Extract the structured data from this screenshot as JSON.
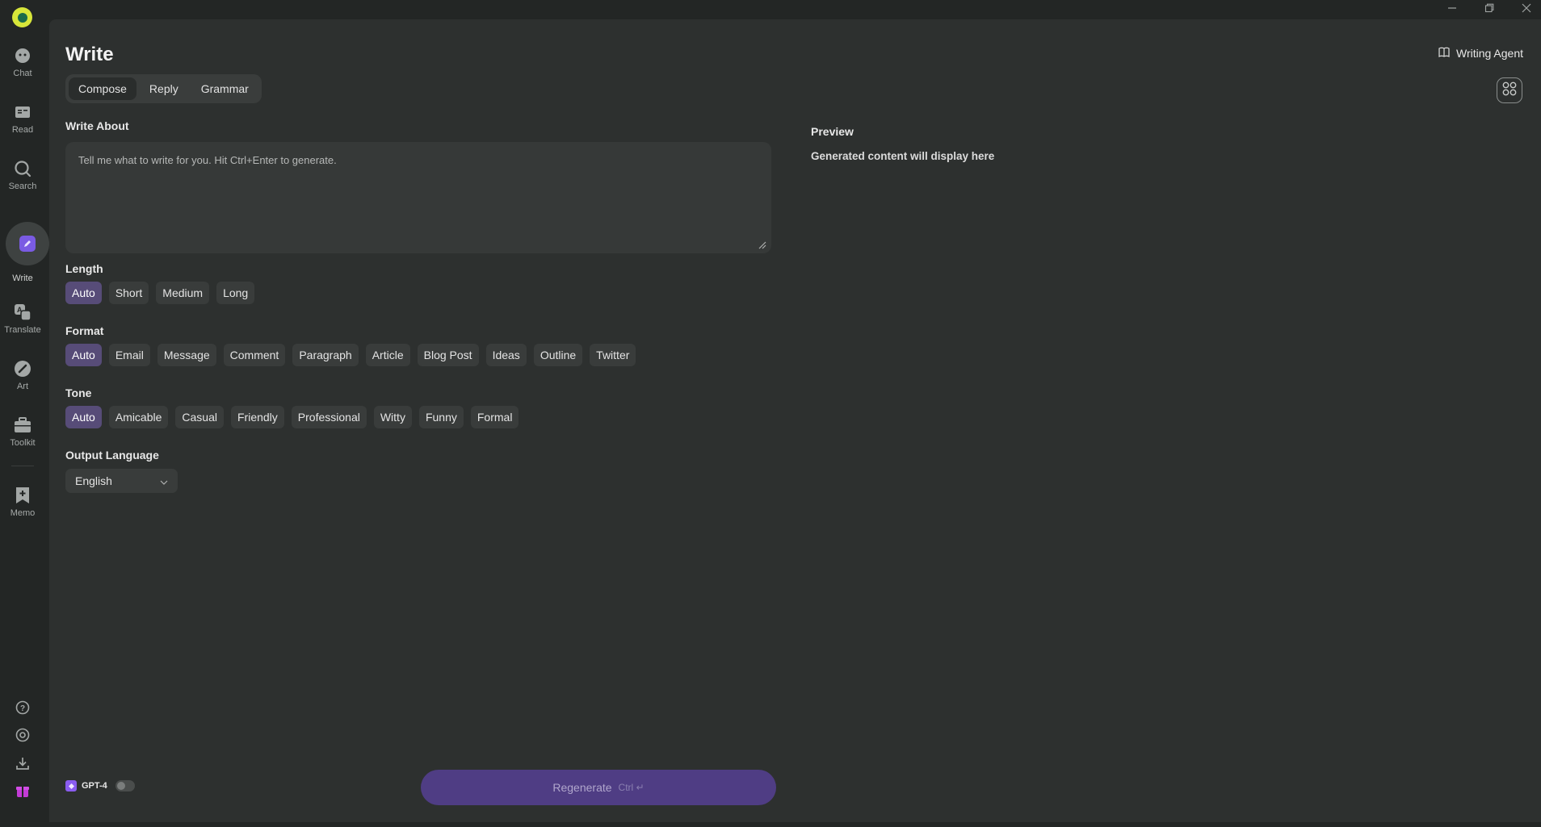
{
  "window": {
    "minimize_icon": "minimize-icon",
    "maximize_icon": "restore-icon",
    "close_icon": "close-icon"
  },
  "sidebar": {
    "items": [
      {
        "label": "Chat",
        "icon": "chat-icon"
      },
      {
        "label": "Read",
        "icon": "read-icon"
      },
      {
        "label": "Search",
        "icon": "search-icon"
      },
      {
        "label": "Write",
        "icon": "write-icon",
        "active": true
      },
      {
        "label": "Translate",
        "icon": "translate-icon"
      },
      {
        "label": "Art",
        "icon": "art-icon"
      },
      {
        "label": "Toolkit",
        "icon": "toolkit-icon"
      },
      {
        "label": "Memo",
        "icon": "memo-icon"
      }
    ],
    "utilities": [
      "help-icon",
      "settings-icon",
      "download-icon",
      "gift-icon"
    ]
  },
  "page": {
    "title": "Write",
    "tabs": [
      {
        "label": "Compose",
        "active": true
      },
      {
        "label": "Reply"
      },
      {
        "label": "Grammar"
      }
    ],
    "agent_label": "Writing Agent"
  },
  "write_about": {
    "label": "Write About",
    "placeholder": "Tell me what to write for you. Hit Ctrl+Enter to generate."
  },
  "length": {
    "label": "Length",
    "options": [
      "Auto",
      "Short",
      "Medium",
      "Long"
    ],
    "selected": "Auto"
  },
  "format": {
    "label": "Format",
    "options": [
      "Auto",
      "Email",
      "Message",
      "Comment",
      "Paragraph",
      "Article",
      "Blog Post",
      "Ideas",
      "Outline",
      "Twitter"
    ],
    "selected": "Auto"
  },
  "tone": {
    "label": "Tone",
    "options": [
      "Auto",
      "Amicable",
      "Casual",
      "Friendly",
      "Professional",
      "Witty",
      "Funny",
      "Formal"
    ],
    "selected": "Auto"
  },
  "output_language": {
    "label": "Output Language",
    "value": "English"
  },
  "preview": {
    "title": "Preview",
    "placeholder": "Generated content will display here"
  },
  "footer": {
    "model_label": "GPT-4",
    "regenerate_label": "Regenerate",
    "regenerate_hint": "Ctrl ↵"
  },
  "colors": {
    "accent": "#574c78",
    "brand": "#7a5be3",
    "background": "#2d302f"
  }
}
